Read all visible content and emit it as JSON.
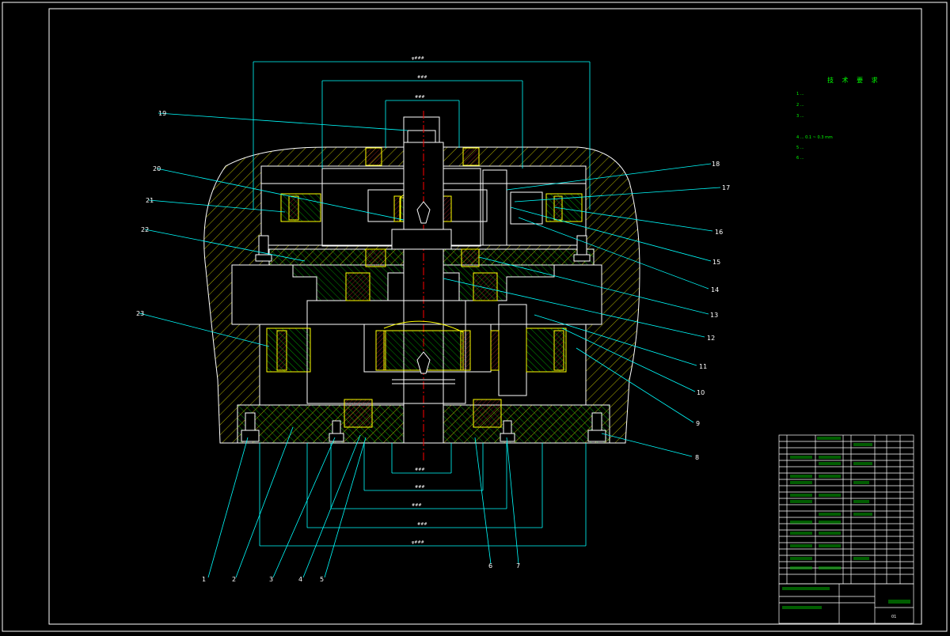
{
  "drawing": {
    "part_numbers": [
      {
        "label": "1"
      },
      {
        "label": "2"
      },
      {
        "label": "3"
      },
      {
        "label": "4"
      },
      {
        "label": "5"
      },
      {
        "label": "6"
      },
      {
        "label": "7"
      },
      {
        "label": "8"
      },
      {
        "label": "9"
      },
      {
        "label": "10"
      },
      {
        "label": "11"
      },
      {
        "label": "12"
      },
      {
        "label": "13"
      },
      {
        "label": "14"
      },
      {
        "label": "15"
      },
      {
        "label": "16"
      },
      {
        "label": "17"
      },
      {
        "label": "18"
      },
      {
        "label": "19"
      },
      {
        "label": "20"
      },
      {
        "label": "21"
      },
      {
        "label": "22"
      },
      {
        "label": "23"
      }
    ]
  },
  "tech_requirements": {
    "title": "技 术 要 求",
    "lines": [
      "1 ...",
      "2 ...",
      "3 ...",
      "4 ... 0.1 ~ 0.3 mm",
      "5 ...",
      "6 ..."
    ]
  },
  "title_block": {
    "drawing_code": "01"
  }
}
